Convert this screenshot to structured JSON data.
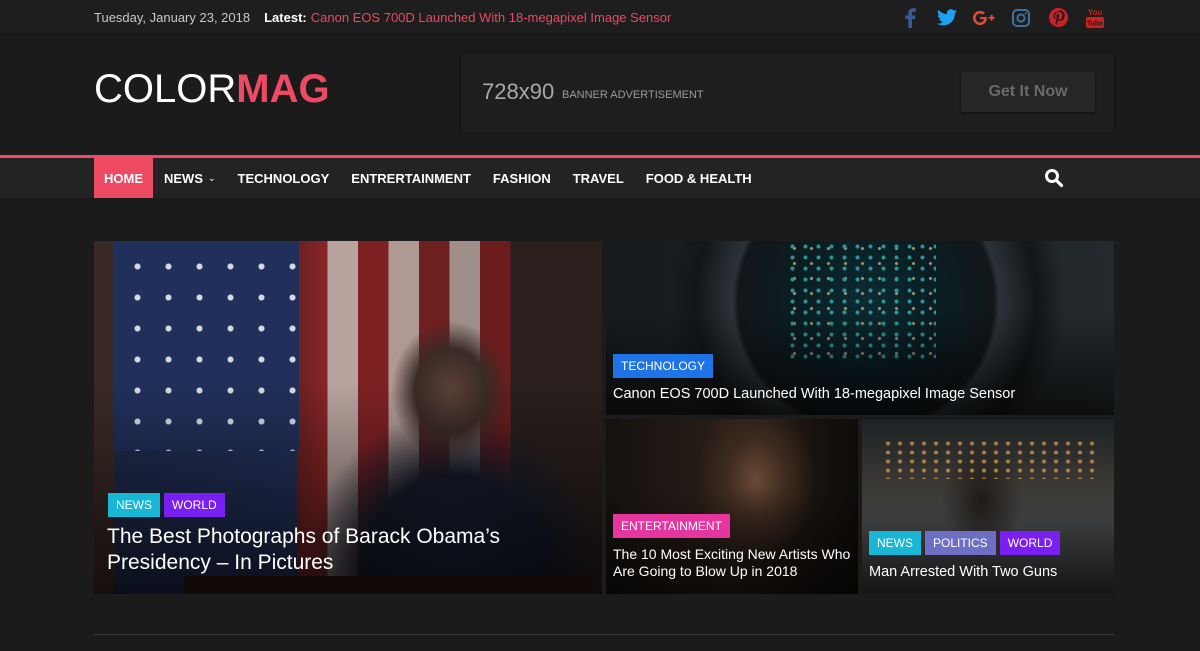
{
  "topbar": {
    "date": "Tuesday, January 23, 2018",
    "latest_label": "Latest:",
    "latest_link": "Canon EOS 700D Launched With 18-megapixel Image Sensor",
    "social": [
      {
        "icon": "facebook-icon",
        "color": "#3b5998"
      },
      {
        "icon": "twitter-icon",
        "color": "#1da1f2"
      },
      {
        "icon": "google-plus-icon",
        "color": "#dd4b39"
      },
      {
        "icon": "instagram-icon",
        "color": "#3f729b"
      },
      {
        "icon": "pinterest-icon",
        "color": "#cb2027"
      },
      {
        "icon": "youtube-icon",
        "color": "#cd201f"
      }
    ]
  },
  "header": {
    "logo_part1": "COLOR",
    "logo_part2": "MAG",
    "banner_size": "728x90",
    "banner_text": "BANNER ADVERTISEMENT",
    "banner_cta": "Get It Now"
  },
  "nav": {
    "items": [
      {
        "label": "HOME",
        "active": true
      },
      {
        "label": "NEWS",
        "dropdown": true
      },
      {
        "label": "TECHNOLOGY"
      },
      {
        "label": "ENTRERTAINMENT"
      },
      {
        "label": "FASHION"
      },
      {
        "label": "TRAVEL"
      },
      {
        "label": "FOOD & HEALTH"
      }
    ],
    "search_icon": "search-icon"
  },
  "colors": {
    "accent": "#ef4a63",
    "news": "#18b7d6",
    "world": "#7a1ff2",
    "technology": "#1e73e6",
    "entertainment": "#e5359e",
    "politics": "#6e6ec4"
  },
  "featured": [
    {
      "categories": [
        "NEWS",
        "WORLD"
      ],
      "title": "The Best Photographs of Barack Obama’s Presidency – In Pictures"
    },
    {
      "categories": [
        "TECHNOLOGY"
      ],
      "title": "Canon EOS 700D Launched With 18-megapixel Image Sensor"
    },
    {
      "categories": [
        "ENTERTAINMENT"
      ],
      "title": "The 10 Most Exciting New Artists Who Are Going to Blow Up in 2018"
    },
    {
      "categories": [
        "NEWS",
        "POLITICS",
        "WORLD"
      ],
      "title": "Man Arrested With Two Guns"
    }
  ]
}
